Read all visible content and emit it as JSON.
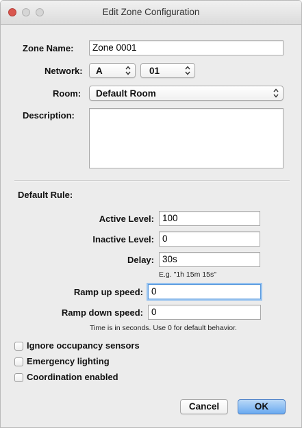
{
  "window": {
    "title": "Edit Zone Configuration",
    "controls": [
      "close-button",
      "minimize-button",
      "zoom-button"
    ]
  },
  "zone": {
    "name_label": "Zone Name:",
    "name_value": "Zone 0001",
    "network_label": "Network:",
    "network_value": "A",
    "network_number": "01",
    "room_label": "Room:",
    "room_value": "Default Room",
    "description_label": "Description:",
    "description_value": ""
  },
  "default_rule": {
    "section_label": "Default Rule:",
    "active_level_label": "Active Level:",
    "active_level_value": "100",
    "inactive_level_label": "Inactive Level:",
    "inactive_level_value": "0",
    "delay_label": "Delay:",
    "delay_value": "30s",
    "delay_hint": "E.g. \"1h 15m 15s\"",
    "ramp_up_label": "Ramp up speed:",
    "ramp_up_value": "0",
    "ramp_down_label": "Ramp down speed:",
    "ramp_down_value": "0",
    "ramp_hint": "Time is in seconds.  Use 0 for default behavior."
  },
  "options": [
    {
      "label": "Ignore occupancy sensors",
      "checked": false
    },
    {
      "label": "Emergency lighting",
      "checked": false
    },
    {
      "label": "Coordination enabled",
      "checked": false
    }
  ],
  "buttons": {
    "cancel": "Cancel",
    "ok": "OK"
  },
  "colors": {
    "window_bg": "#ececec",
    "default_button": "#6aaaf0",
    "focus_ring": "#97c3f0",
    "close_button": "#d9574f"
  }
}
